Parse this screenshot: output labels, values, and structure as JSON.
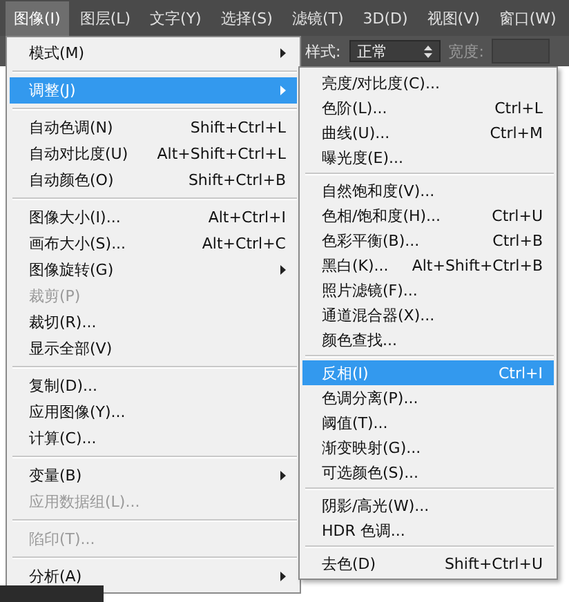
{
  "menubar": [
    {
      "label": "图像(I)",
      "selected": true
    },
    {
      "label": "图层(L)",
      "selected": false
    },
    {
      "label": "文字(Y)",
      "selected": false
    },
    {
      "label": "选择(S)",
      "selected": false
    },
    {
      "label": "滤镜(T)",
      "selected": false
    },
    {
      "label": "3D(D)",
      "selected": false
    },
    {
      "label": "视图(V)",
      "selected": false
    },
    {
      "label": "窗口(W)",
      "selected": false
    }
  ],
  "options_bar": {
    "style_label": "样式:",
    "style_value": "正常",
    "width_label": "宽度:"
  },
  "image_menu": [
    {
      "kind": "item",
      "label": "模式(M)",
      "submenu": true,
      "disabled": false,
      "selected": false
    },
    {
      "kind": "separator"
    },
    {
      "kind": "item",
      "label": "调整(J)",
      "submenu": true,
      "disabled": false,
      "selected": true
    },
    {
      "kind": "separator"
    },
    {
      "kind": "item",
      "label": "自动色调(N)",
      "shortcut": "Shift+Ctrl+L",
      "submenu": false,
      "disabled": false,
      "selected": false
    },
    {
      "kind": "item",
      "label": "自动对比度(U)",
      "shortcut": "Alt+Shift+Ctrl+L",
      "submenu": false,
      "disabled": false,
      "selected": false
    },
    {
      "kind": "item",
      "label": "自动颜色(O)",
      "shortcut": "Shift+Ctrl+B",
      "submenu": false,
      "disabled": false,
      "selected": false
    },
    {
      "kind": "separator"
    },
    {
      "kind": "item",
      "label": "图像大小(I)...",
      "shortcut": "Alt+Ctrl+I",
      "submenu": false,
      "disabled": false,
      "selected": false
    },
    {
      "kind": "item",
      "label": "画布大小(S)...",
      "shortcut": "Alt+Ctrl+C",
      "submenu": false,
      "disabled": false,
      "selected": false
    },
    {
      "kind": "item",
      "label": "图像旋转(G)",
      "submenu": true,
      "disabled": false,
      "selected": false
    },
    {
      "kind": "item",
      "label": "裁剪(P)",
      "submenu": false,
      "disabled": true,
      "selected": false
    },
    {
      "kind": "item",
      "label": "裁切(R)...",
      "submenu": false,
      "disabled": false,
      "selected": false
    },
    {
      "kind": "item",
      "label": "显示全部(V)",
      "submenu": false,
      "disabled": false,
      "selected": false
    },
    {
      "kind": "separator"
    },
    {
      "kind": "item",
      "label": "复制(D)...",
      "submenu": false,
      "disabled": false,
      "selected": false
    },
    {
      "kind": "item",
      "label": "应用图像(Y)...",
      "submenu": false,
      "disabled": false,
      "selected": false
    },
    {
      "kind": "item",
      "label": "计算(C)...",
      "submenu": false,
      "disabled": false,
      "selected": false
    },
    {
      "kind": "separator"
    },
    {
      "kind": "item",
      "label": "变量(B)",
      "submenu": true,
      "disabled": false,
      "selected": false
    },
    {
      "kind": "item",
      "label": "应用数据组(L)...",
      "submenu": false,
      "disabled": true,
      "selected": false
    },
    {
      "kind": "separator"
    },
    {
      "kind": "item",
      "label": "陷印(T)...",
      "submenu": false,
      "disabled": true,
      "selected": false
    },
    {
      "kind": "separator"
    },
    {
      "kind": "item",
      "label": "分析(A)",
      "submenu": true,
      "disabled": false,
      "selected": false
    }
  ],
  "adjust_submenu": [
    {
      "kind": "item",
      "label": "亮度/对比度(C)...",
      "selected": false
    },
    {
      "kind": "item",
      "label": "色阶(L)...",
      "shortcut": "Ctrl+L",
      "selected": false
    },
    {
      "kind": "item",
      "label": "曲线(U)...",
      "shortcut": "Ctrl+M",
      "selected": false
    },
    {
      "kind": "item",
      "label": "曝光度(E)...",
      "selected": false
    },
    {
      "kind": "separator"
    },
    {
      "kind": "item",
      "label": "自然饱和度(V)...",
      "selected": false
    },
    {
      "kind": "item",
      "label": "色相/饱和度(H)...",
      "shortcut": "Ctrl+U",
      "selected": false
    },
    {
      "kind": "item",
      "label": "色彩平衡(B)...",
      "shortcut": "Ctrl+B",
      "selected": false
    },
    {
      "kind": "item",
      "label": "黑白(K)...",
      "shortcut": "Alt+Shift+Ctrl+B",
      "selected": false
    },
    {
      "kind": "item",
      "label": "照片滤镜(F)...",
      "selected": false
    },
    {
      "kind": "item",
      "label": "通道混合器(X)...",
      "selected": false
    },
    {
      "kind": "item",
      "label": "颜色查找...",
      "selected": false
    },
    {
      "kind": "separator"
    },
    {
      "kind": "item",
      "label": "反相(I)",
      "shortcut": "Ctrl+I",
      "selected": true
    },
    {
      "kind": "item",
      "label": "色调分离(P)...",
      "selected": false
    },
    {
      "kind": "item",
      "label": "阈值(T)...",
      "selected": false
    },
    {
      "kind": "item",
      "label": "渐变映射(G)...",
      "selected": false
    },
    {
      "kind": "item",
      "label": "可选颜色(S)...",
      "selected": false
    },
    {
      "kind": "separator"
    },
    {
      "kind": "item",
      "label": "阴影/高光(W)...",
      "selected": false
    },
    {
      "kind": "item",
      "label": "HDR 色调...",
      "selected": false
    },
    {
      "kind": "separator"
    },
    {
      "kind": "item",
      "label": "去色(D)",
      "shortcut": "Shift+Ctrl+U",
      "selected": false
    }
  ]
}
